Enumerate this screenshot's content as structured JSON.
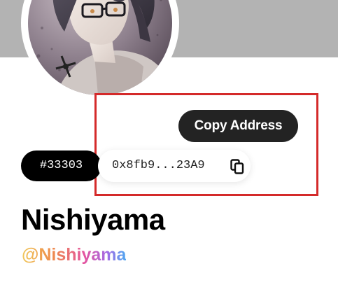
{
  "profile": {
    "name": "Nishiyama",
    "handle": "@Nishiyama",
    "id_badge": "#33303",
    "address_short": "0x8fb9...23A9"
  },
  "tooltip": {
    "label": "Copy Address"
  },
  "icons": {
    "copy": "copy-icon"
  },
  "colors": {
    "banner": "#b3b3b3",
    "tooltip_bg": "#232323",
    "id_pill_bg": "#000000",
    "highlight_border": "#d42a2a",
    "handle_gradient": [
      "#f0c85a",
      "#ee8a4c",
      "#e455a0",
      "#a46be6",
      "#4fa8f0"
    ]
  }
}
